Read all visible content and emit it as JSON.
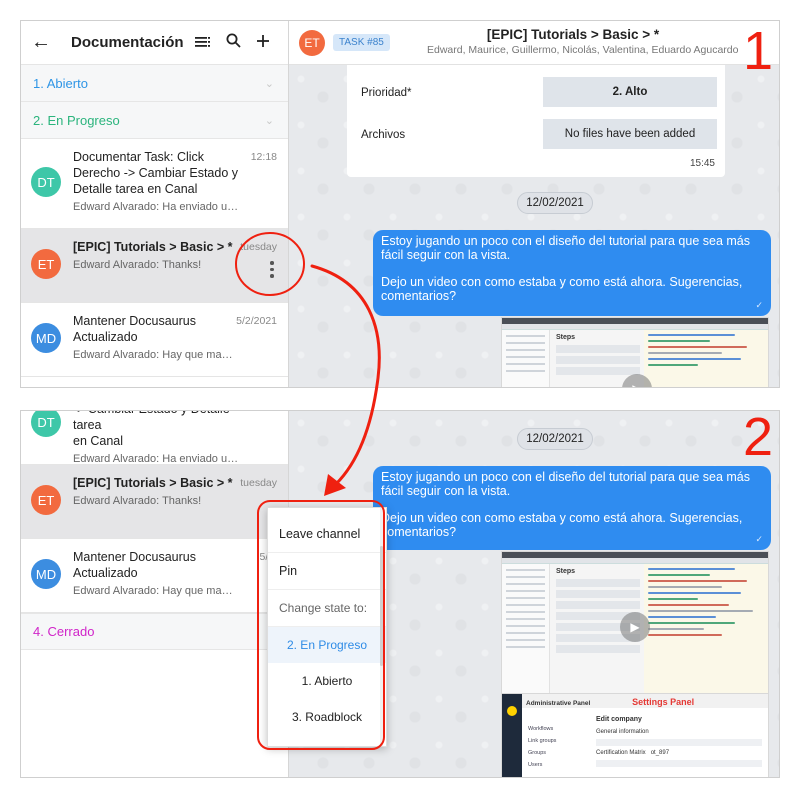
{
  "sidebar": {
    "title": "Documentación",
    "back_icon": "arrow-left-icon",
    "tools": [
      "sort-list-icon",
      "search-icon",
      "plus-icon"
    ],
    "groups": [
      {
        "label": "1. Abierto",
        "color": "#2e95e6"
      },
      {
        "label": "2. En Progreso",
        "color": "#2bb47d"
      },
      {
        "label": "4. Cerrado",
        "color": "#d025c9"
      }
    ],
    "conversations": [
      {
        "initials": "DT",
        "title": "Documentar Task: Click Derecho -> Cambiar Estado y Detalle tarea en Canal",
        "title_cont": "-> Cambiar Estado y Detalle tarea",
        "title_end": "en Canal",
        "subtitle": "Edward Alvarado: Ha enviado un for...",
        "time": "12:18",
        "color": "#3ec7a8"
      },
      {
        "initials": "ET",
        "title": "[EPIC] Tutorials > Basic > *",
        "subtitle": "Edward Alvarado: Thanks!",
        "time": "tuesday",
        "color": "#f26a3f"
      },
      {
        "initials": "MD",
        "title": "Mantener Docusaurus",
        "title2": "Actualizado",
        "subtitle": "Edward Alvarado: Hay que mante...",
        "subtitle_cut": "Edward Alvarado: Hay que mante...",
        "time": "5/2/2021",
        "time_cut": "5/2/",
        "color": "#3c8de0"
      }
    ]
  },
  "channel": {
    "avatar": "ET",
    "badge": "TASK #85",
    "title": "[EPIC] Tutorials > Basic > *",
    "members": "Edward, Maurice, Guillermo, Nicolás, Valentina, Eduardo Agucardo"
  },
  "form": {
    "priority_label": "Prioridad*",
    "priority_value": "2. Alto",
    "files_label": "Archivos",
    "files_value": "No files have been added",
    "time": "15:45"
  },
  "date_pill": "12/02/2021",
  "message": {
    "line1": "Estoy jugando un poco con el diseño del tutorial para que sea más fácil seguir con la vista.",
    "line2": "Dejo un video con como estaba y como está ahora. Sugerencias, comentarios?",
    "status_icon": "check-icon"
  },
  "video_thumb": {
    "heading": "Steps",
    "play_icon": "play-icon"
  },
  "admin_thumb": {
    "title": "Administrative Panel",
    "subtitle": "Settings Panel",
    "menu": [
      "Workflows",
      "Link groups",
      "Groups",
      "Users"
    ],
    "form_title": "Edit company",
    "form_section": "General information",
    "field_name": "Certification Matrix",
    "field_code": "ot_897"
  },
  "context_menu": {
    "items": [
      "Leave channel",
      "Pin"
    ],
    "section": "Change state to:",
    "states": [
      "2. En Progreso",
      "1. Abierto",
      "3. Roadblock"
    ],
    "current_state": "2. En Progreso"
  },
  "steps": [
    "1",
    "2"
  ],
  "annotation_color": "#ef2010"
}
